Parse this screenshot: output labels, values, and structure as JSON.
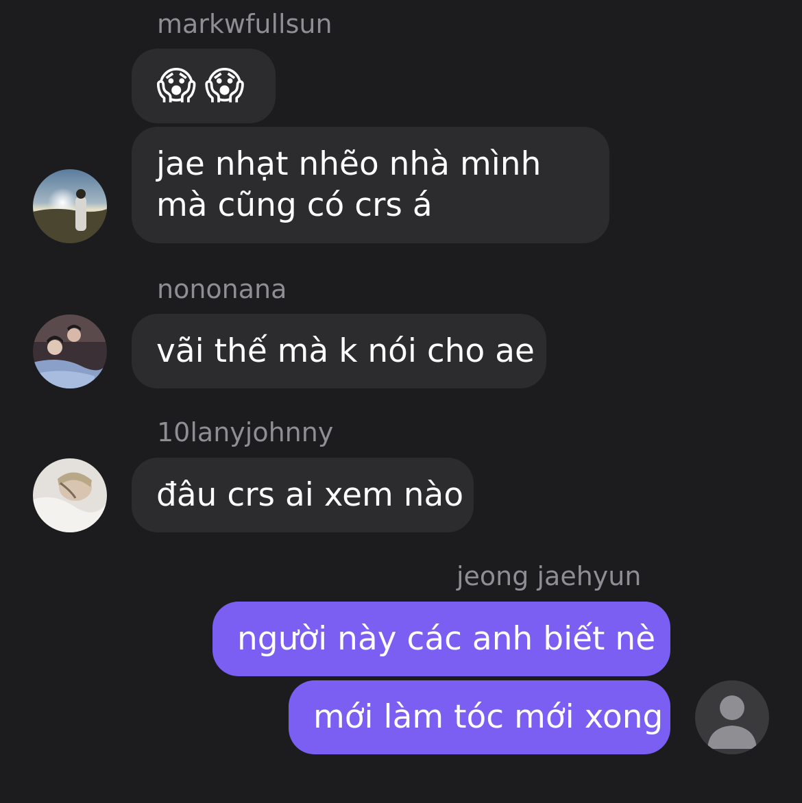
{
  "messages": [
    {
      "sender": "markwfullsun",
      "bubbles": [
        {
          "type": "emoji",
          "emojis": [
            "😱",
            "😱"
          ]
        },
        {
          "type": "text",
          "text": "jae nhạt nhẽo nhà mình mà cũng có crs á"
        }
      ],
      "avatar": "avatar-sunset-photo"
    },
    {
      "sender": "nononana",
      "bubbles": [
        {
          "type": "text",
          "text": "vãi thế mà k nói cho ae"
        }
      ],
      "avatar": "avatar-group-photo"
    },
    {
      "sender": "10lanyjohnny",
      "bubbles": [
        {
          "type": "text",
          "text": "đâu crs ai xem nào"
        }
      ],
      "avatar": "avatar-pillow-photo"
    },
    {
      "sender": "jeong jaehyun",
      "bubbles": [
        {
          "type": "text",
          "text": "người này các anh biết nè"
        },
        {
          "type": "text",
          "text": "mới làm tóc mới xong"
        }
      ],
      "avatar": "avatar-default-person",
      "outgoing": true
    }
  ],
  "colors": {
    "background": "#1c1c1e",
    "incoming_bubble": "#2c2c2e",
    "outgoing_bubble": "#7b5ef2",
    "sender_text": "#8e8e93"
  }
}
